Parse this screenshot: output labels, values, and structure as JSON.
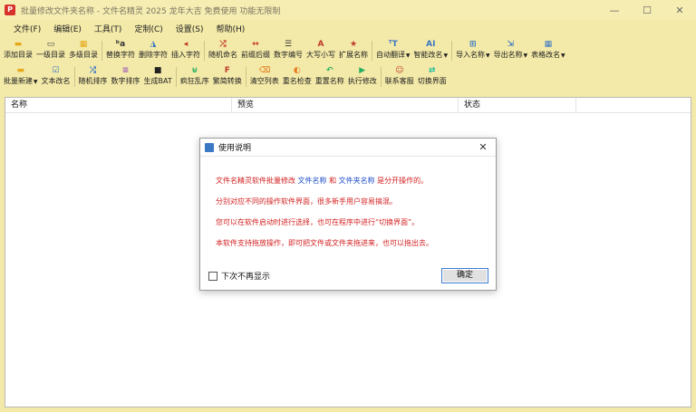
{
  "window": {
    "app_icon_glyph": "P",
    "title": "批量修改文件夹名称 - 文件名精灵 2025 龙年大吉 免费使用 功能无限制",
    "controls": [
      "—",
      "☐",
      "✕"
    ]
  },
  "menu": [
    "文件(F)",
    "编辑(E)",
    "工具(T)",
    "定制(C)",
    "设置(S)",
    "帮助(H)"
  ],
  "toolbar1": [
    {
      "label": "添加目录",
      "icon": "folder-add-icon",
      "glyph": "▬",
      "color": "#e6a817"
    },
    {
      "label": "一级目录",
      "icon": "folder-level1-icon",
      "glyph": "▭",
      "color": "#444"
    },
    {
      "label": "多级目录",
      "icon": "folder-multi-icon",
      "glyph": "▦",
      "color": "#e6a817"
    },
    {
      "label": "替换字符",
      "icon": "replace-icon",
      "glyph": "ᵇa",
      "color": "#333"
    },
    {
      "label": "删除字符",
      "icon": "delete-char-icon",
      "glyph": "◮",
      "color": "#3b78c4"
    },
    {
      "label": "插入字符",
      "icon": "insert-char-icon",
      "glyph": "◂",
      "color": "#c0392b"
    },
    {
      "label": "随机命名",
      "icon": "random-name-icon",
      "glyph": "⤮",
      "color": "#c0392b"
    },
    {
      "label": "前缀后缀",
      "icon": "prefix-suffix-icon",
      "glyph": "↔",
      "color": "#c0392b"
    },
    {
      "label": "数字编号",
      "icon": "number-icon",
      "glyph": "☰",
      "color": "#333"
    },
    {
      "label": "大写小写",
      "icon": "case-icon",
      "glyph": "A",
      "color": "#c0392b"
    },
    {
      "label": "扩展名称",
      "icon": "extension-icon",
      "glyph": "★",
      "color": "#c0392b"
    },
    {
      "label": "自动翻译",
      "icon": "translate-icon",
      "glyph": "ᵀT",
      "color": "#3b78c4",
      "dropdown": true
    },
    {
      "label": "智能改名",
      "icon": "ai-icon",
      "glyph": "AI",
      "color": "#3b78c4",
      "dropdown": true
    },
    {
      "label": "导入名称",
      "icon": "import-icon",
      "glyph": "⊞",
      "color": "#3b78c4",
      "dropdown": true
    },
    {
      "label": "导出名称",
      "icon": "export-icon",
      "glyph": "⇲",
      "color": "#3b78c4",
      "dropdown": true
    },
    {
      "label": "表格改名",
      "icon": "table-icon",
      "glyph": "▦",
      "color": "#3b78c4",
      "dropdown": true
    }
  ],
  "toolbar2": [
    {
      "label": "批量新建",
      "icon": "batch-new-icon",
      "glyph": "▬",
      "color": "#e6a817",
      "dropdown": true
    },
    {
      "label": "文本改名",
      "icon": "text-rename-icon",
      "glyph": "☑",
      "color": "#3b78c4"
    },
    {
      "label": "随机排序",
      "icon": "random-sort-icon",
      "glyph": "⤮",
      "color": "#3b78c4"
    },
    {
      "label": "数字排序",
      "icon": "number-sort-icon",
      "glyph": "≡",
      "color": "#9b59b6"
    },
    {
      "label": "生成BAT",
      "icon": "bat-icon",
      "glyph": "■",
      "color": "#222"
    },
    {
      "label": "疯狂乱序",
      "icon": "shuffle-icon",
      "glyph": "⊌",
      "color": "#27ae60"
    },
    {
      "label": "繁简转换",
      "icon": "convert-icon",
      "glyph": "F",
      "color": "#c0392b"
    },
    {
      "label": "清空列表",
      "icon": "clear-list-icon",
      "glyph": "⌫",
      "color": "#e67e22"
    },
    {
      "label": "重名检查",
      "icon": "duplicate-check-icon",
      "glyph": "◐",
      "color": "#e67e22"
    },
    {
      "label": "重置名称",
      "icon": "reset-icon",
      "glyph": "↶",
      "color": "#27ae60"
    },
    {
      "label": "执行修改",
      "icon": "execute-icon",
      "glyph": "▶",
      "color": "#27ae60"
    },
    {
      "label": "联系客服",
      "icon": "support-icon",
      "glyph": "☺",
      "color": "#c0392b"
    },
    {
      "label": "切换界面",
      "icon": "switch-ui-icon",
      "glyph": "⇄",
      "color": "#1abc9c"
    }
  ],
  "list": {
    "columns": [
      "名称",
      "预览",
      "状态"
    ]
  },
  "dialog": {
    "title": "使用说明",
    "close": "✕",
    "line1": {
      "a": "文件名精灵软件批量修改 ",
      "b": "文件名称",
      "c": " 和 ",
      "d": "文件夹名称",
      "e": " 是分开操作的。"
    },
    "line2": "分别对应不同的操作软件界面，很多新手用户容易搞混。",
    "line3": "您可以在软件启动时进行选择，也可在程序中进行“切换界面”。",
    "line4": "本软件支持拖放操作，即可把文件或文件夹拖进来，也可以拖出去。",
    "checkbox_label": "下次不再显示",
    "ok_label": "确定"
  }
}
